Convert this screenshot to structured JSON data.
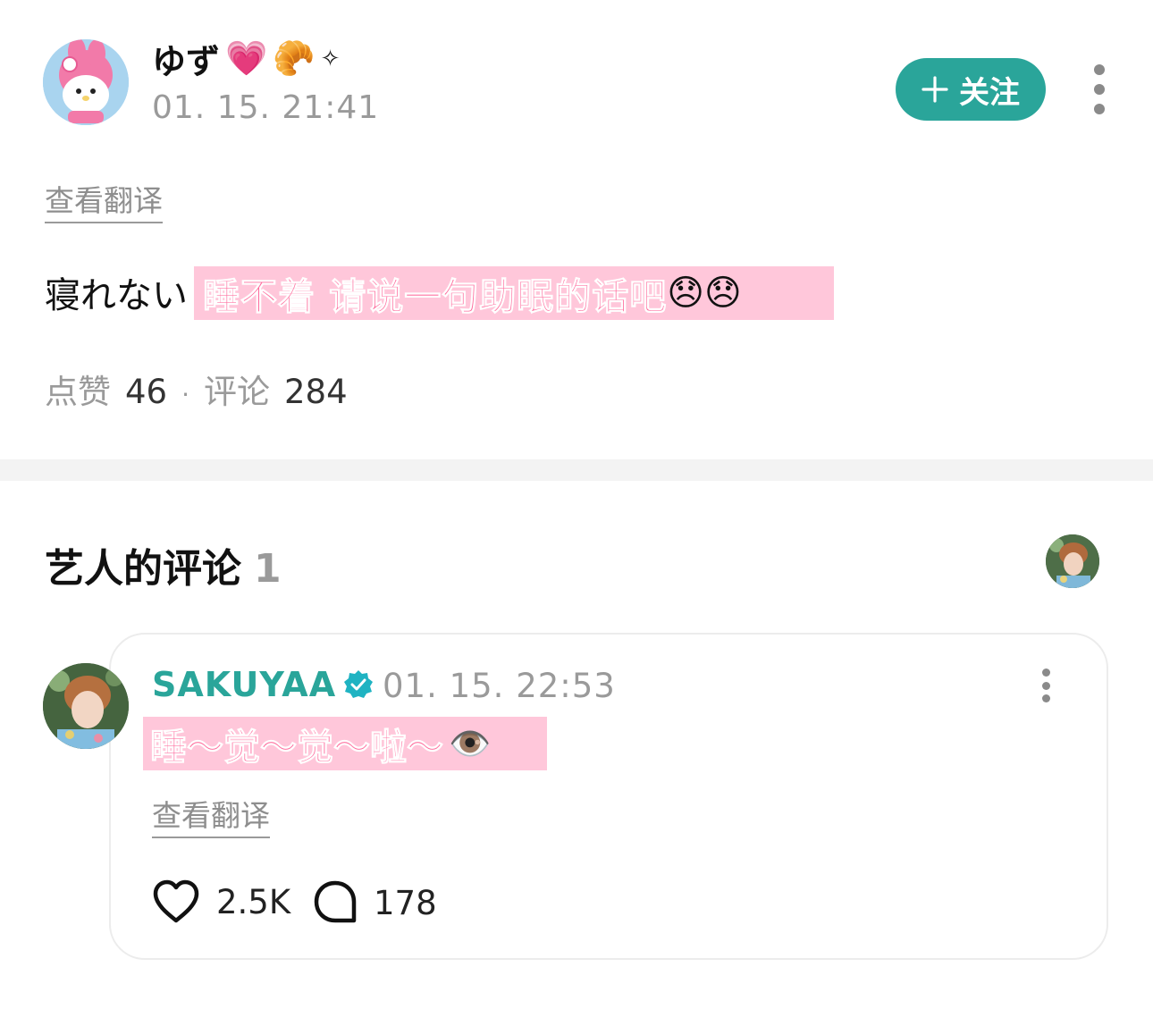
{
  "post": {
    "username": "ゆず",
    "username_emojis": [
      "💗",
      "🥐",
      "✧"
    ],
    "time": "01. 15. 21:41",
    "follow_label": "关注",
    "translate_label": "查看翻译",
    "body_text": "寝れない",
    "sticker_text": "睡不着 请说一句助眠的话吧",
    "sticker_emojis": "😞😞",
    "stats": {
      "likes_label": "点赞",
      "likes": "46",
      "separator": "·",
      "comments_label": "评论",
      "comments": "284"
    }
  },
  "artist_comments": {
    "title": "艺人的评论",
    "count": "1"
  },
  "comment": {
    "author": "SAKUYAA",
    "time": "01. 15. 22:53",
    "sticker_text": "睡～觉～觉～啦～",
    "sticker_emoji": "👁️",
    "translate_label": "查看翻译",
    "likes": "2.5K",
    "replies": "178"
  },
  "colors": {
    "accent": "#2aa59a",
    "sticker_bg": "#ffc7da",
    "sticker_text": "#ff6a9c",
    "muted_text": "#9a9a9a",
    "divider": "#f3f3f3"
  },
  "icons": {
    "follow": "plus-icon",
    "more": "more-vertical-icon",
    "verified": "verified-badge-icon",
    "like": "heart-outline-icon",
    "reply": "speech-bubble-icon"
  }
}
